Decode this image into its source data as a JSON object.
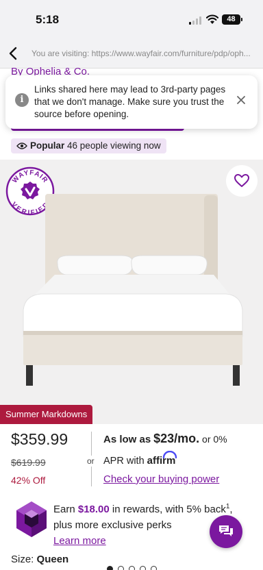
{
  "status_bar": {
    "time": "5:18",
    "battery": "48"
  },
  "url_bar": {
    "visiting_text": "You are visiting: https://www.wayfair.com/furniture/pdp/oph..."
  },
  "brand": {
    "prefix": "By",
    "name": "Ophelia & Co."
  },
  "toast": {
    "message": "Links shared here may lead to 3rd-party pages that we don't manage. Make sure you trust the source before opening.",
    "info_icon": "info-icon",
    "close_icon": "close-icon"
  },
  "popularity": {
    "label": "Popular",
    "text": "46 people viewing now"
  },
  "badge": {
    "top_text": "WAYFAIR",
    "bottom_text": "VERIFIED"
  },
  "image_carousel": {
    "tag": "Summer Markdowns",
    "slide_count": 5,
    "active_index": 0
  },
  "pricing": {
    "price": "$359.99",
    "old_price": "$619.99",
    "discount": "42% Off",
    "or_label": "or",
    "as_low_as": "As low as",
    "monthly": "$23/mo.",
    "or_zero": "or 0%",
    "apr_with": "APR with",
    "affirm": "affirm",
    "buying_power_link": "Check your buying power"
  },
  "rewards": {
    "earn": "Earn",
    "amount": "$18.00",
    "after_amount": "in rewards, with 5% back",
    "superscript": "1",
    "line2": "plus more exclusive perks",
    "learn_more": "Learn more"
  },
  "size": {
    "label": "Size:",
    "value": "Queen"
  },
  "colors": {
    "brand_purple": "#7b189f",
    "sale_red": "#ad1a3e",
    "popular_bg": "#efe3f5"
  }
}
